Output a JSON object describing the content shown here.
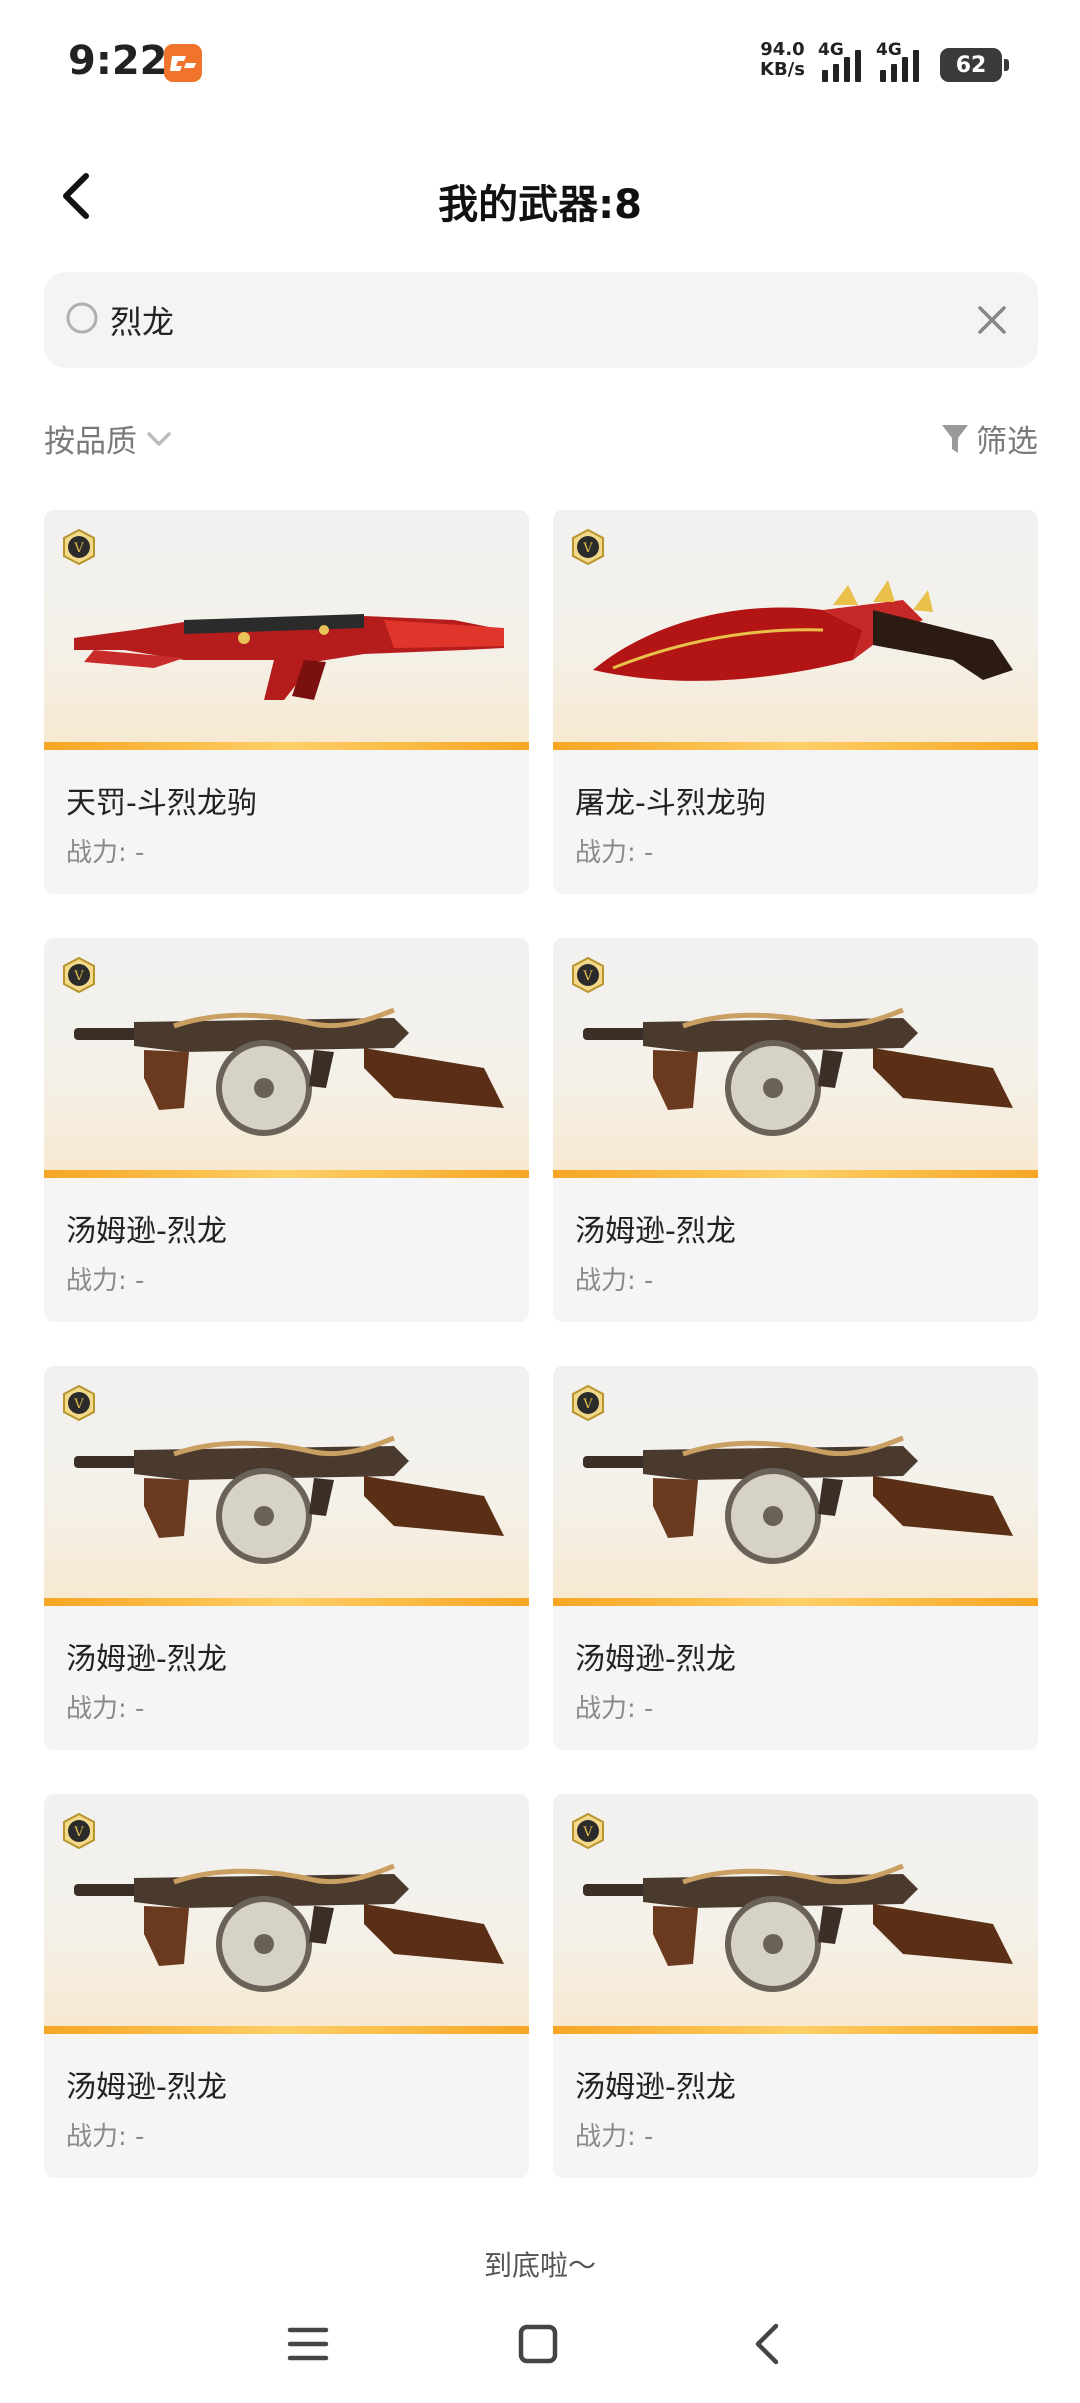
{
  "status_bar": {
    "time": "9:22",
    "net_speed_value": "94.0",
    "net_speed_unit": "KB/s",
    "network_1": "4G",
    "network_2": "4G",
    "battery": "62"
  },
  "header": {
    "title": "我的武器:8"
  },
  "search": {
    "value": "烈龙"
  },
  "toolbar": {
    "sort_label": "按品质",
    "filter_label": "筛选"
  },
  "weapons": [
    {
      "name": "天罚-斗烈龙驹",
      "power": "战力: -",
      "type": "rifle"
    },
    {
      "name": "屠龙-斗烈龙驹",
      "power": "战力: -",
      "type": "knife"
    },
    {
      "name": "汤姆逊-烈龙",
      "power": "战力: -",
      "type": "smg"
    },
    {
      "name": "汤姆逊-烈龙",
      "power": "战力: -",
      "type": "smg"
    },
    {
      "name": "汤姆逊-烈龙",
      "power": "战力: -",
      "type": "smg"
    },
    {
      "name": "汤姆逊-烈龙",
      "power": "战力: -",
      "type": "smg"
    },
    {
      "name": "汤姆逊-烈龙",
      "power": "战力: -",
      "type": "smg"
    },
    {
      "name": "汤姆逊-烈龙",
      "power": "战力: -",
      "type": "smg"
    }
  ],
  "footer": {
    "end_text": "到底啦～"
  },
  "colors": {
    "accent": "#f5a623",
    "brand": "#f0742b"
  }
}
